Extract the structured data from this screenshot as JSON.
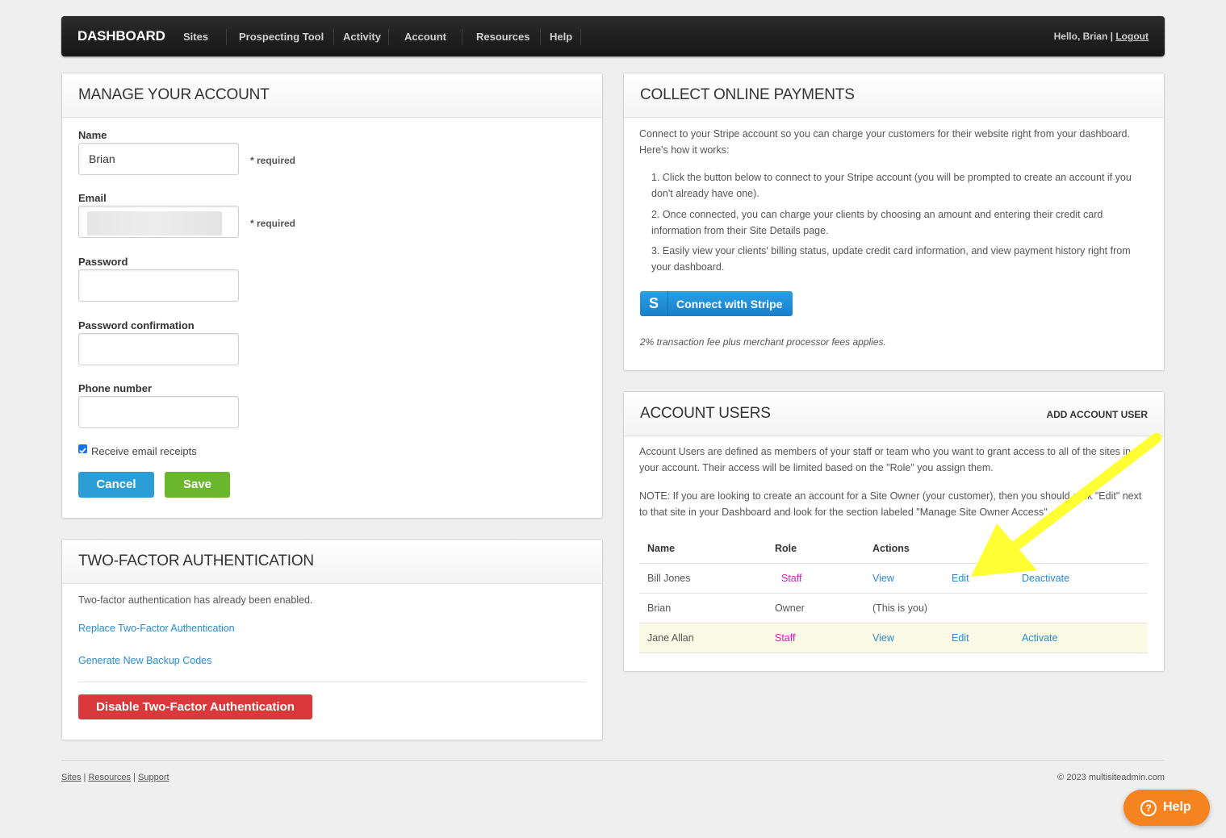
{
  "nav": {
    "brand": "DASHBOARD",
    "items": [
      "Sites",
      "Prospecting Tool",
      "Activity",
      "Account",
      "Resources",
      "Help"
    ],
    "greeting": "Hello, Brian",
    "separator": "|",
    "logout": "Logout"
  },
  "manage": {
    "title": "MANAGE YOUR ACCOUNT",
    "name_label": "Name",
    "name_value": "Brian",
    "required": "* required",
    "email_label": "Email",
    "password_label": "Password",
    "password_confirmation_label": "Password confirmation",
    "phone_label": "Phone number",
    "receipts_label": "Receive email receipts",
    "receipts_checked": true,
    "cancel": "Cancel",
    "save": "Save"
  },
  "twofactor": {
    "title": "TWO-FACTOR AUTHENTICATION",
    "status": "Two-factor authentication has already been enabled.",
    "replace": "Replace Two-Factor Authentication",
    "backup": "Generate New Backup Codes",
    "disable": "Disable Two-Factor Authentication"
  },
  "payments": {
    "title": "COLLECT ONLINE PAYMENTS",
    "intro": "Connect to your Stripe account so you can charge your customers for their website right from your dashboard. Here's how it works:",
    "steps": [
      "1. Click the button below to connect to your Stripe account (you will be prompted to create an account if you don't already have one).",
      "2. Once connected, you can charge your clients by choosing an amount and entering their credit card information from their Site Details page.",
      "3. Easily view your clients' billing status, update credit card information, and view payment history right from your dashboard."
    ],
    "stripe_button": "Connect with Stripe",
    "stripe_logo": "S",
    "fee_note": "2% transaction fee plus merchant processor fees applies."
  },
  "users": {
    "title": "ACCOUNT USERS",
    "add": "ADD ACCOUNT USER",
    "desc": "Account Users are defined as members of your staff or team who you want to grant access to all of the sites in your account. Their access will be limited based on the \"Role\" you assign them.",
    "note": "NOTE: If you are looking to create an account for a Site Owner (your customer), then you should click \"Edit\" next to that site in your Dashboard and look for the section labeled \"Manage Site Owner Access\".",
    "columns": [
      "Name",
      "Role",
      "Actions"
    ],
    "rows": [
      {
        "name": "Bill Jones",
        "role": "Staff",
        "view": "View",
        "edit": "Edit",
        "toggle": "Deactivate"
      },
      {
        "name": "Brian",
        "role": "Owner",
        "self": "(This is you)"
      },
      {
        "name": "Jane Allan",
        "role": "Staff",
        "view": "View",
        "edit": "Edit",
        "toggle": "Activate"
      }
    ]
  },
  "footer": {
    "links": [
      "Sites",
      "Resources",
      "Support"
    ],
    "sep": "|",
    "copyright": "© 2023 multisiteadmin.com"
  },
  "help_widget": {
    "label": "Help",
    "icon": "question-icon",
    "color": "#f5831f"
  },
  "annotation": {
    "arrow_color": "#ffff33"
  }
}
